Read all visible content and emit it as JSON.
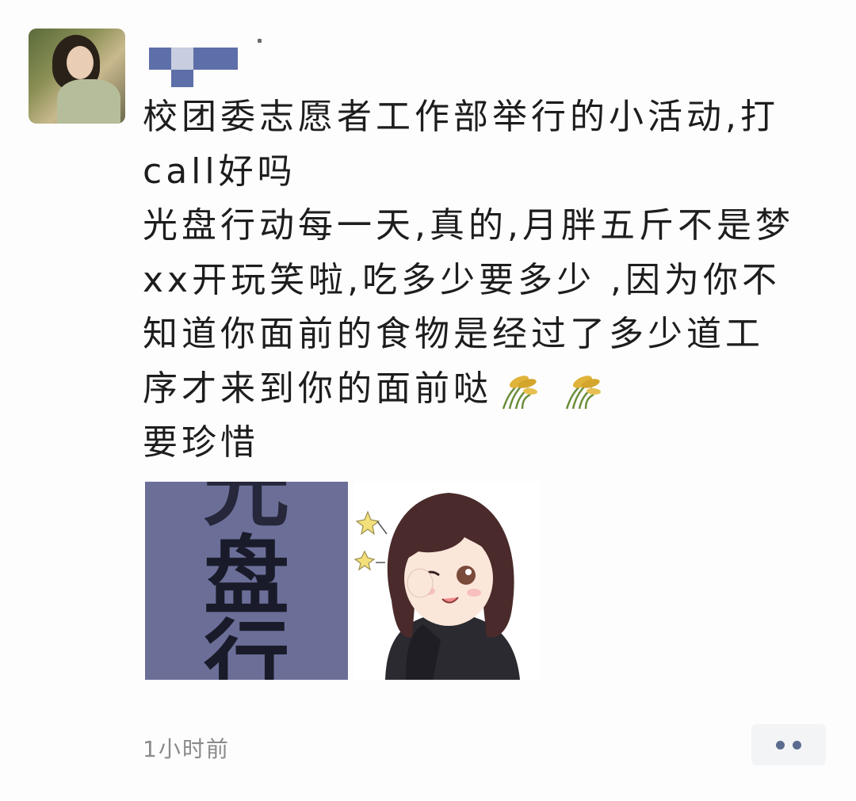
{
  "post": {
    "lines": [
      "校团委志愿者工作部举行的小活动,打",
      "call好吗",
      "光盘行动每一天,真的,月胖五斤不是梦",
      "xx开玩笑啦,吃多少要多少 ,因为你不",
      "知道你面前的食物是经过了多少道工",
      "序才来到你的面前哒",
      "要珍惜"
    ],
    "emoji_names": [
      "rice-icon",
      "rice-icon"
    ],
    "time": "1小时前"
  },
  "images": {
    "photo_text": [
      "光",
      "盘",
      "行"
    ]
  },
  "colors": {
    "mosaic": "#5d6fa8",
    "text": "#1d1d1d",
    "timestamp": "#8a8a8a",
    "more_dots": "#5b6b8f",
    "more_bg": "#f3f4f6"
  }
}
